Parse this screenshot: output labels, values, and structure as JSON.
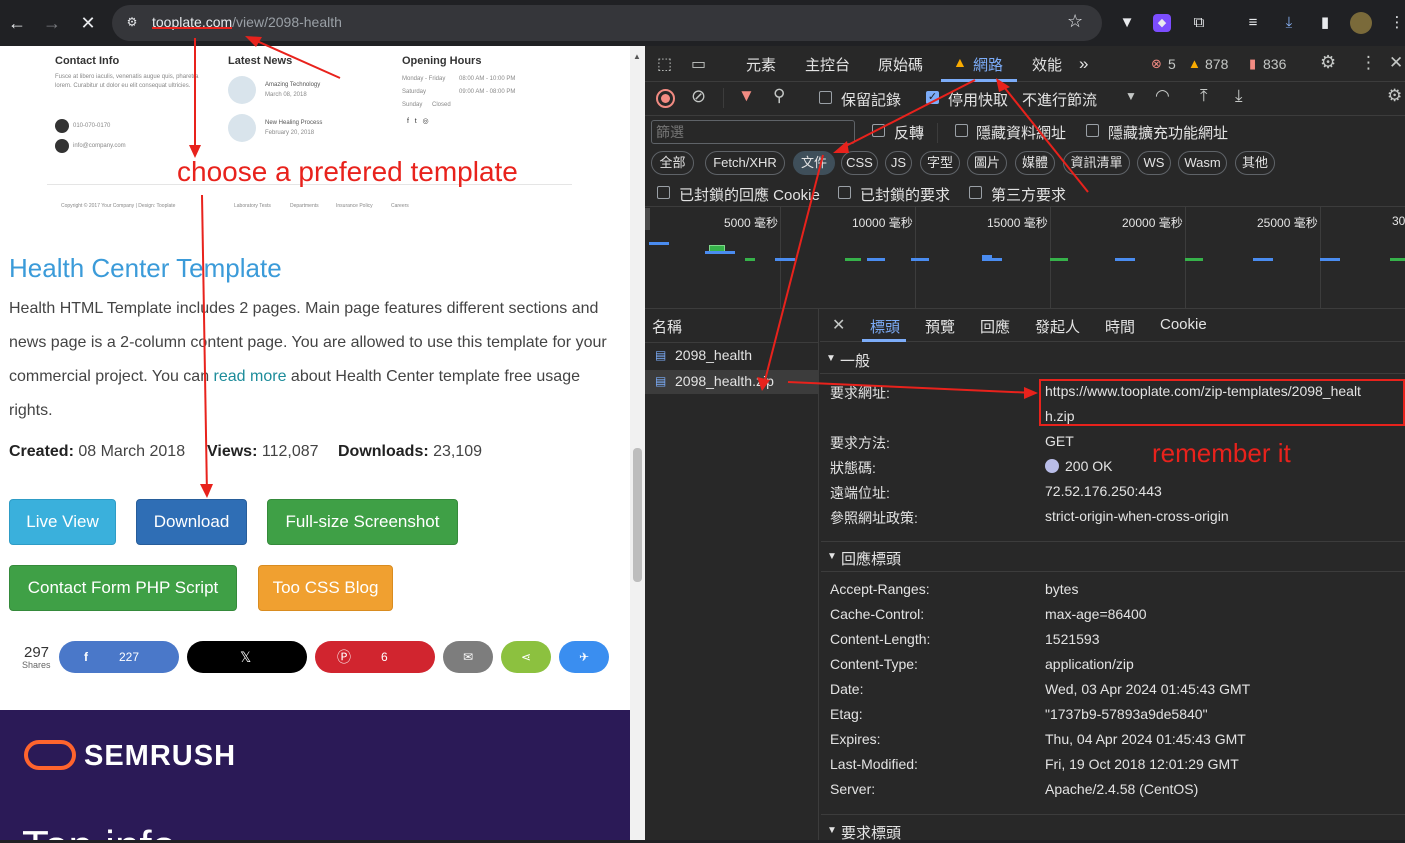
{
  "browser": {
    "url_host": "tooplate.com",
    "url_path": "/view/2098-health"
  },
  "page": {
    "footer_image": {
      "contact_title": "Contact Info",
      "contact_text": "Fusce at libero iaculis, venenatis augue quis, pharetra lorem. Curabitur ut dolor eu elit consequat ultricies.",
      "phone": "010-070-0170",
      "email": "info@company.com",
      "news_title": "Latest News",
      "news1_title": "Amazing Technology",
      "news1_date": "March 08, 2018",
      "news2_title": "New Healing Process",
      "news2_date": "February 20, 2018",
      "hours_title": "Opening Hours",
      "hours1_day": "Monday - Friday",
      "hours1_time": "08:00 AM - 10:00 PM",
      "hours2_day": "Saturday",
      "hours2_time": "09:00 AM - 08:00 PM",
      "hours3_day": "Sunday",
      "hours3_time": "Closed",
      "copyright": "Copyright © 2017 Your Company | Design: Tooplate",
      "links": [
        "Laboratory Tests",
        "Departments",
        "Insurance Policy",
        "Careers"
      ]
    },
    "title": "Health Center Template",
    "desc_before": "Health HTML Template includes 2 pages. Main page features different sections and news page is a 2-column content page. You are allowed to use this template for your commercial project. You can ",
    "desc_link": "read more",
    "desc_after": " about Health Center template free usage rights.",
    "created_label": "Created:",
    "created_value": "08 March 2018",
    "views_label": "Views:",
    "views_value": "112,087",
    "downloads_label": "Downloads:",
    "downloads_value": "23,109",
    "buttons": {
      "live_view": "Live View",
      "download": "Download",
      "screenshot": "Full-size Screenshot",
      "contact_form": "Contact Form PHP Script",
      "blog": "Too CSS Blog"
    },
    "shares_count": "297",
    "shares_label": "Shares",
    "facebook_count": "227",
    "pinterest_count": "6",
    "ad_brand": "SEMRUSH",
    "ad_text": "Top info"
  },
  "devtools": {
    "tabs": [
      "元素",
      "主控台",
      "原始碼",
      "網路",
      "效能"
    ],
    "active_tab": "網路",
    "errors": "5",
    "warnings": "878",
    "issues": "836",
    "preserve_log": "保留記錄",
    "disable_cache": "停用快取",
    "throttling": "不進行節流",
    "filter_placeholder": "篩選",
    "invert": "反轉",
    "hide_data_urls": "隱藏資料網址",
    "hide_extension_urls": "隱藏擴充功能網址",
    "chips": [
      "全部",
      "Fetch/XHR",
      "文件",
      "CSS",
      "JS",
      "字型",
      "圖片",
      "媒體",
      "資訊清單",
      "WS",
      "Wasm",
      "其他"
    ],
    "active_chip": "文件",
    "blocked_cookies": "已封鎖的回應 Cookie",
    "blocked_requests": "已封鎖的要求",
    "third_party": "第三方要求",
    "timeline_labels": [
      "5000 毫秒",
      "10000 毫秒",
      "15000 毫秒",
      "20000 毫秒",
      "25000 毫秒",
      "30"
    ],
    "name_header": "名稱",
    "requests": [
      "2098_health",
      "2098_health.zip"
    ],
    "detail_tabs": [
      "標頭",
      "預覽",
      "回應",
      "發起人",
      "時間",
      "Cookie"
    ],
    "general_title": "一般",
    "general": [
      {
        "k": "要求網址:",
        "v": "https://www.tooplate.com/zip-templates/2098_healt"
      },
      {
        "k": "",
        "v": "h.zip"
      },
      {
        "k": "要求方法:",
        "v": "GET"
      },
      {
        "k": "狀態碼:",
        "v": "200 OK"
      },
      {
        "k": "遠端位址:",
        "v": "72.52.176.250:443"
      },
      {
        "k": "參照網址政策:",
        "v": "strict-origin-when-cross-origin"
      }
    ],
    "response_title": "回應標頭",
    "response": [
      {
        "k": "Accept-Ranges:",
        "v": "bytes"
      },
      {
        "k": "Cache-Control:",
        "v": "max-age=86400"
      },
      {
        "k": "Content-Length:",
        "v": "1521593"
      },
      {
        "k": "Content-Type:",
        "v": "application/zip"
      },
      {
        "k": "Date:",
        "v": "Wed, 03 Apr 2024 01:45:43 GMT"
      },
      {
        "k": "Etag:",
        "v": "\"1737b9-57893a9de5840\""
      },
      {
        "k": "Expires:",
        "v": "Thu, 04 Apr 2024 01:45:43 GMT"
      },
      {
        "k": "Last-Modified:",
        "v": "Fri, 19 Oct 2018 12:01:29 GMT"
      },
      {
        "k": "Server:",
        "v": "Apache/2.4.58 (CentOS)"
      }
    ],
    "request_title": "要求標頭"
  },
  "annotations": {
    "choose": "choose a prefered template",
    "remember": "remember it"
  },
  "colors": {
    "annotation_red": "#e8221c",
    "link_blue": "#3b9bd9",
    "download_btn": "#2f6eb5",
    "green_btn": "#3fa046",
    "orange_btn": "#f0a030"
  }
}
